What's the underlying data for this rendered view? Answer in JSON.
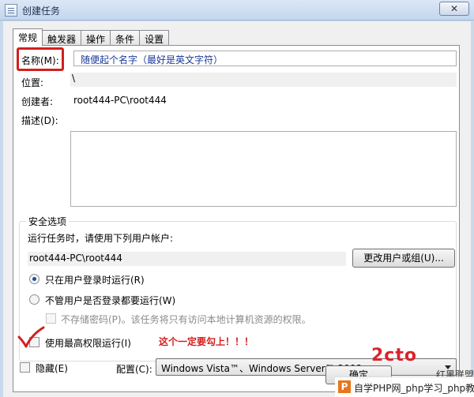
{
  "window": {
    "title": "创建任务",
    "close_glyph": "✕"
  },
  "tabs": [
    {
      "label": "常规",
      "active": true
    },
    {
      "label": "触发器",
      "active": false
    },
    {
      "label": "操作",
      "active": false
    },
    {
      "label": "条件",
      "active": false
    },
    {
      "label": "设置",
      "active": false
    }
  ],
  "general": {
    "name_label": "名称(M):",
    "name_value": "随便起个名字（最好是英文字符）",
    "location_label": "位置:",
    "location_value": "\\",
    "author_label": "创建者:",
    "author_value": "root444-PC\\root444",
    "description_label": "描述(D):",
    "description_value": ""
  },
  "security": {
    "group_title": "安全选项",
    "run_as_label": "运行任务时，请使用下列用户帐户:",
    "account_value": "root444-PC\\root444",
    "change_user_button": "更改用户或组(U)...",
    "radio_logged_on": "只在用户登录时运行(R)",
    "radio_whether": "不管用户是否登录都要运行(W)",
    "do_not_store_password": "不存储密码(P)。该任务将只有访问本地计算机资源的权限。",
    "highest_privileges": "使用最高权限运行(I)",
    "annotation": "这个一定要勾上！！！"
  },
  "footer": {
    "hidden_label": "隐藏(E)",
    "configure_label": "配置(C):",
    "configure_value": "Windows Vista™、Windows Server™ 2008",
    "ok_button": "确定"
  },
  "watermark": {
    "logo_glyph": "P",
    "text": "自学PHP网_php学习_php教",
    "brand_big": "2cto",
    "brand_small": "红黑联盟"
  },
  "colors": {
    "annotation_red": "#d31f1f",
    "checkmark_red": "#d31f1f"
  }
}
